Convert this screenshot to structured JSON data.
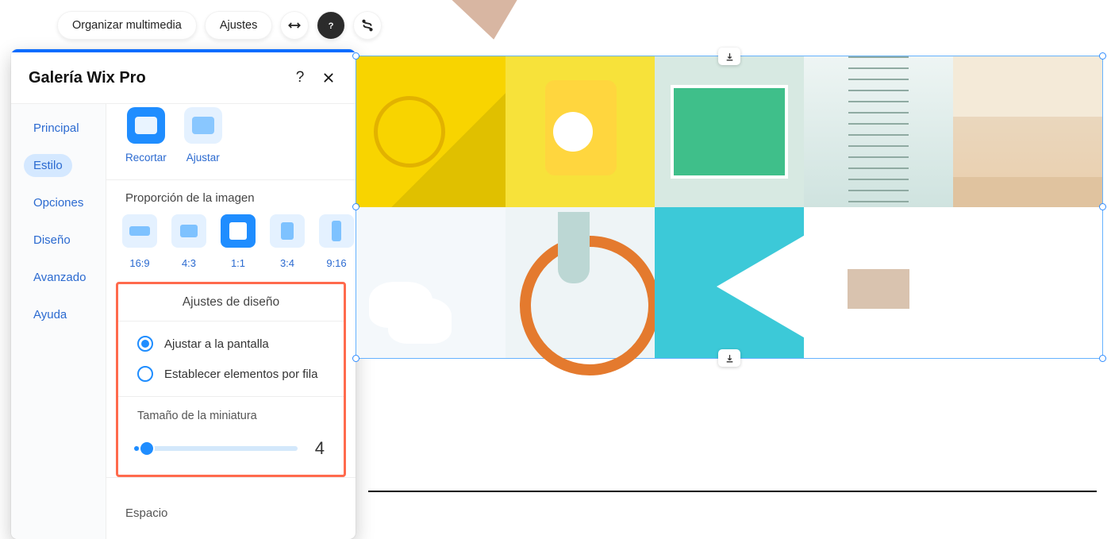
{
  "toolbar": {
    "organize": "Organizar multimedia",
    "settings": "Ajustes"
  },
  "panel": {
    "title": "Galería Wix Pro",
    "menu": {
      "principal": "Principal",
      "estilo": "Estilo",
      "opciones": "Opciones",
      "diseno": "Diseño",
      "avanzado": "Avanzado",
      "ayuda": "Ayuda"
    },
    "thumb": {
      "recortar": "Recortar",
      "ajustar": "Ajustar"
    },
    "proportion_label": "Proporción de la imagen",
    "ratios": {
      "r169": "16:9",
      "r43": "4:3",
      "r11": "1:1",
      "r34": "3:4",
      "r916": "9:16"
    },
    "design": {
      "heading": "Ajustes de diseño",
      "fit_screen": "Ajustar a la pantalla",
      "per_row": "Establecer elementos por fila"
    },
    "thumb_size": {
      "label": "Tamaño de la miniatura",
      "value": "4"
    },
    "spacing_label": "Espacio"
  }
}
